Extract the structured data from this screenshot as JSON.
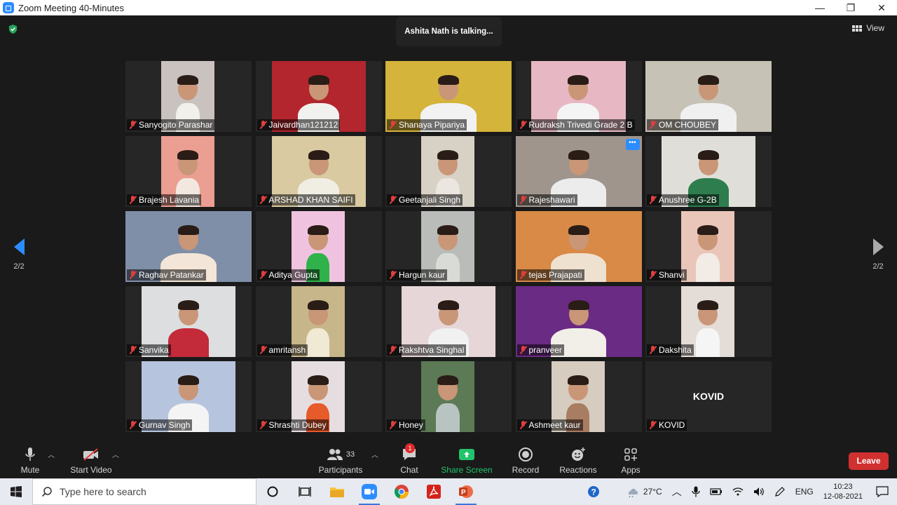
{
  "window": {
    "title": "Zoom Meeting 40-Minutes",
    "minimize": "—",
    "maximize": "❐",
    "close": "✕"
  },
  "meeting": {
    "talking_indicator": "Ashita Nath is talking...",
    "view_label": "View",
    "page_left": "2/2",
    "page_right": "2/2"
  },
  "participants": [
    {
      "name": "Sanyogito Parashar",
      "bg": "#c9c2bf",
      "fg": "#f2f0ea"
    },
    {
      "name": "Jaivardhan121212",
      "bg": "#b3262e",
      "fg": "#f1f1ef"
    },
    {
      "name": "Shanaya Pipariya",
      "bg": "#d4b43a",
      "fg": "#f2f2f2"
    },
    {
      "name": "Rudraksh Trivedi Grade 2 B",
      "bg": "#e7b8c3",
      "fg": "#f4f4f4"
    },
    {
      "name": "OM CHOUBEY",
      "bg": "#c7c2b6",
      "fg": "#f0f0f0"
    },
    {
      "name": "Brajesh Lavania",
      "bg": "#eb9e92",
      "fg": "#f3e8df"
    },
    {
      "name": "ARSHAD KHAN SAIFI",
      "bg": "#d9caa2",
      "fg": "#f0ede2"
    },
    {
      "name": "Geetanjali Singh",
      "bg": "#d8d1c6",
      "fg": "#ebe6df"
    },
    {
      "name": "Rajeshawari",
      "bg": "#9f958d",
      "fg": "#ececec"
    },
    {
      "name": "Anushree G-2B",
      "bg": "#e0ded9",
      "fg": "#2e7d4f"
    },
    {
      "name": "Raghav  Patankar",
      "bg": "#7f8fa8",
      "fg": "#f3e6d8"
    },
    {
      "name": "Aditya Gupta",
      "bg": "#efc3e0",
      "fg": "#2fb24a"
    },
    {
      "name": "Hargun kaur",
      "bg": "#b9bcb8",
      "fg": "#d9dcd6"
    },
    {
      "name": "tejas Prajapati",
      "bg": "#d88a46",
      "fg": "#efe1cf"
    },
    {
      "name": "Shanvi",
      "bg": "#e9c6b9",
      "fg": "#f3ece6"
    },
    {
      "name": "Sanvika",
      "bg": "#dcdee0",
      "fg": "#c32a3a"
    },
    {
      "name": "amritansh",
      "bg": "#c8b68b",
      "fg": "#f0e9d4"
    },
    {
      "name": "Rakshtva Singhal",
      "bg": "#e6d6d8",
      "fg": "#f1f1f1"
    },
    {
      "name": "pranveer",
      "bg": "#6a2b84",
      "fg": "#f2efe9"
    },
    {
      "name": "Dakshita",
      "bg": "#e3dcd7",
      "fg": "#f5f5f5"
    },
    {
      "name": "Gurnav Singh",
      "bg": "#b7c4dd",
      "fg": "#f4f4f4"
    },
    {
      "name": "Shrashti Dubey",
      "bg": "#e6dde0",
      "fg": "#e75a2a"
    },
    {
      "name": "Honey",
      "bg": "#5c7a55",
      "fg": "#b8c4c2"
    },
    {
      "name": "Ashmeet kaur",
      "bg": "#d6ccbf",
      "fg": "#a97d62"
    },
    {
      "name": "KOVID",
      "bg": "",
      "fg": "",
      "big": "KOVID"
    }
  ],
  "toolbar": {
    "mute": "Mute",
    "start_video": "Start Video",
    "participants": "Participants",
    "participants_count": "33",
    "chat": "Chat",
    "chat_badge": "1",
    "share_screen": "Share Screen",
    "record": "Record",
    "reactions": "Reactions",
    "apps": "Apps",
    "leave": "Leave"
  },
  "taskbar": {
    "search_placeholder": "Type here to search",
    "temperature": "27°C",
    "language": "ENG",
    "time": "10:23",
    "date": "12-08-2021"
  },
  "colors": {
    "accent": "#2d8cff",
    "leave": "#d03030",
    "share": "#22c36b"
  }
}
